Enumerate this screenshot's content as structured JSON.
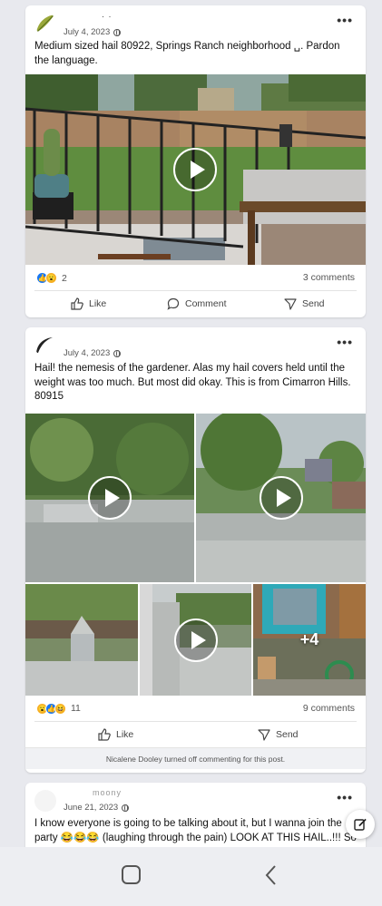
{
  "posts": [
    {
      "author": "· ·",
      "date": "July 4, 2023",
      "text": "Medium sized hail 80922, Springs Ranch neighborhood ␣. Pardon the language.",
      "reaction_count": "2",
      "comments": "3 comments",
      "actions": {
        "like": "Like",
        "comment": "Comment",
        "send": "Send"
      }
    },
    {
      "author": "",
      "date": "July 4, 2023",
      "text": "Hail! the nemesis of the gardener. Alas my hail covers held until the weight was too much. But most did okay. This is from Cimarron Hills. 80915",
      "reaction_count": "11",
      "comments": "9 comments",
      "more_photos": "+4",
      "actions": {
        "like": "Like",
        "send": "Send"
      },
      "notice": "Nicalene Dooley turned off commenting for this post."
    },
    {
      "author": "moony",
      "date": "June 21, 2023",
      "text": "I know everyone is going to be talking about it, but I wanna join the party 😂😂😂 (laughing through the pain) LOOK AT THIS HAIL..!!! So"
    }
  ],
  "icons": {
    "more": "more-options-icon",
    "globe": "public-globe-icon",
    "play": "play-icon",
    "like": "thumbs-up-icon",
    "comment": "comment-bubble-icon",
    "send": "send-icon",
    "compose": "compose-icon"
  },
  "colors": {
    "like_blue": "#1877f2",
    "wow_yellow": "#f7b125",
    "love_red": "#f33e58"
  }
}
